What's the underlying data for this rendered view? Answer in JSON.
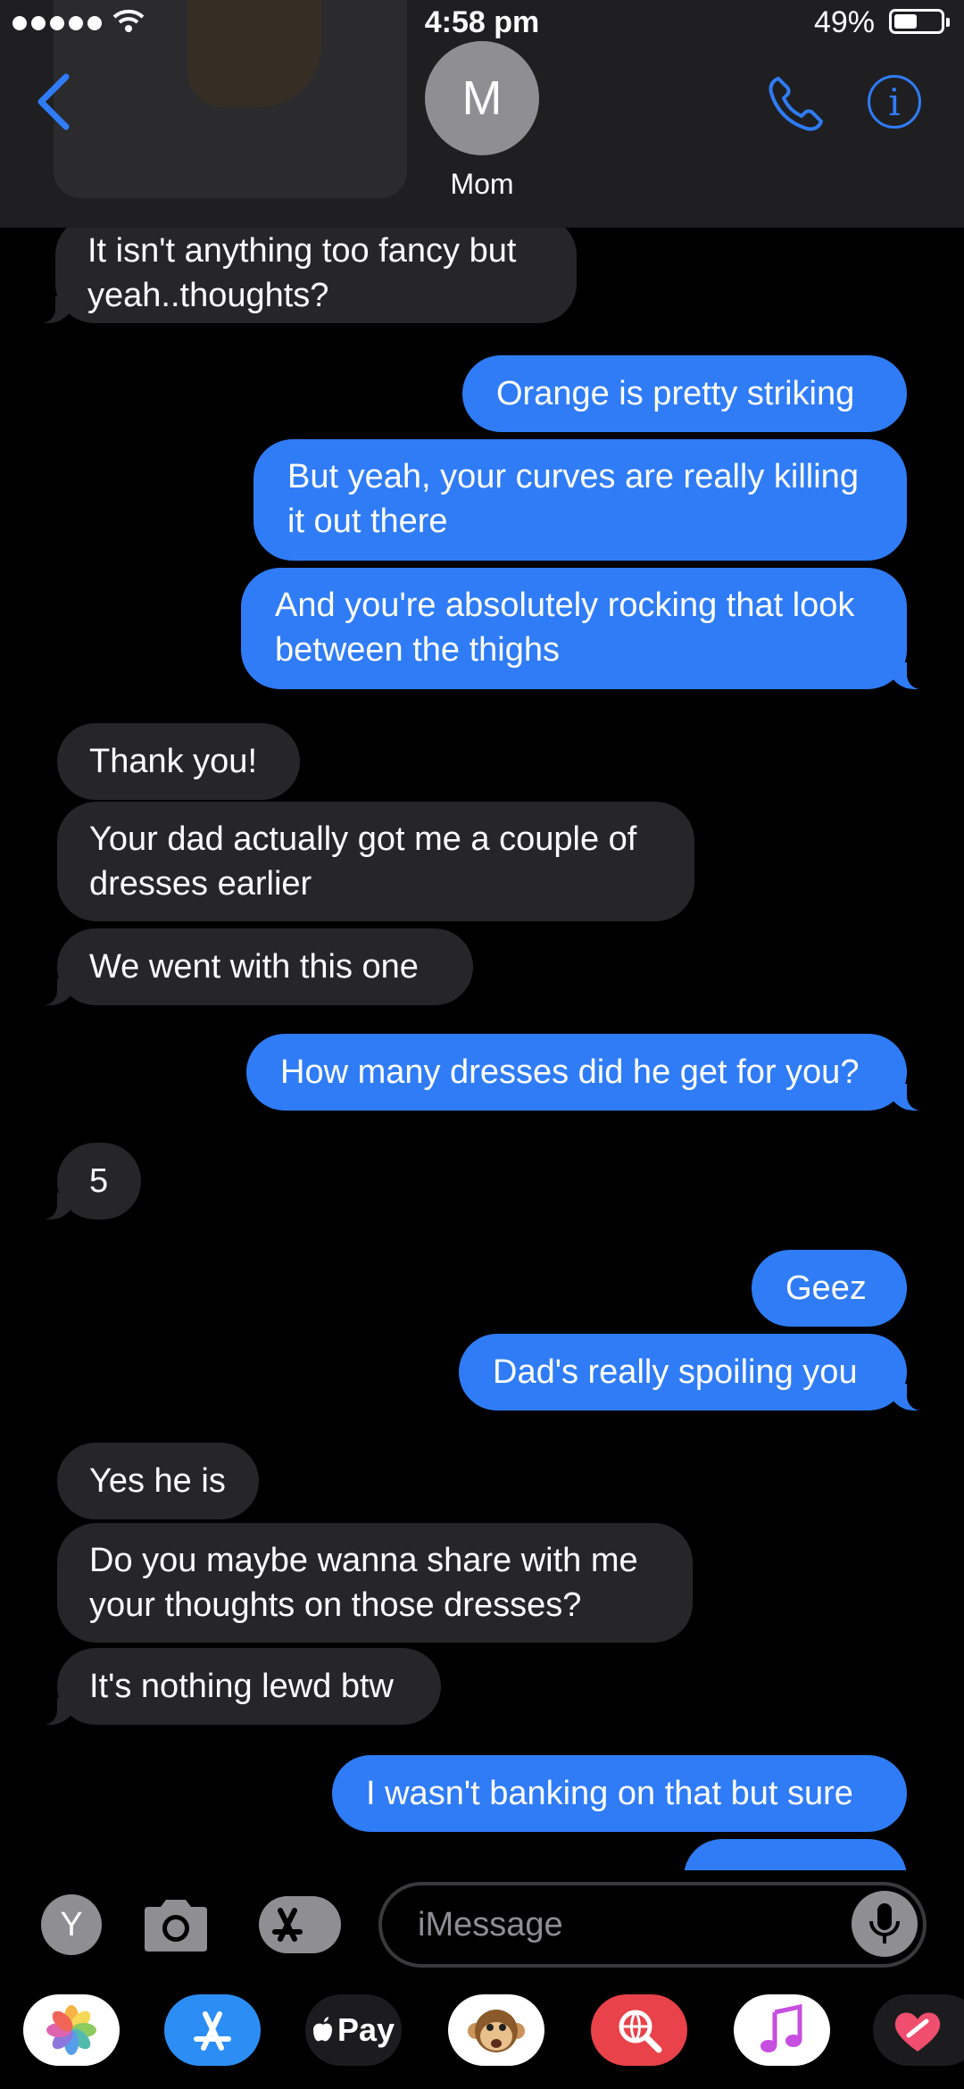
{
  "status_bar": {
    "time": "4:58 pm",
    "battery": "49%",
    "battery_level": 0.49
  },
  "header": {
    "avatar_initial": "M",
    "contact_name": "Mom"
  },
  "messages": [
    {
      "from": "contact",
      "text_lines": [
        "It isn't anything too fancy but",
        "yeah..thoughts?"
      ]
    },
    {
      "from": "me",
      "text": "Orange is pretty striking"
    },
    {
      "from": "me",
      "text_lines": [
        "But yeah, your curves are really killing",
        "it out there"
      ]
    },
    {
      "from": "me",
      "text_lines": [
        "And you're absolutely rocking that look",
        "between the thighs"
      ]
    },
    {
      "from": "contact",
      "text": "Thank you!"
    },
    {
      "from": "contact",
      "text_lines": [
        "Your dad actually got me a couple of",
        "dresses earlier"
      ]
    },
    {
      "from": "contact",
      "text": "We went with this one"
    },
    {
      "from": "me",
      "text": "How many dresses did he get for you?"
    },
    {
      "from": "contact",
      "text": "5"
    },
    {
      "from": "me",
      "text": "Geez"
    },
    {
      "from": "me",
      "text": "Dad's really spoiling you"
    },
    {
      "from": "contact",
      "text": "Yes he is"
    },
    {
      "from": "contact",
      "text_lines": [
        "Do you maybe wanna share with me",
        "your thoughts on those dresses?"
      ]
    },
    {
      "from": "contact",
      "text": "It's nothing lewd btw"
    },
    {
      "from": "me",
      "text": "I wasn't banking on that but sure"
    }
  ],
  "compose": {
    "app_button_letter": "Y",
    "placeholder": "iMessage"
  },
  "app_drawer": {
    "apps": [
      "photos-icon",
      "app-store-icon",
      "apple-pay-icon",
      "animoji-icon",
      "web-search-icon",
      "music-icon",
      "digital-touch-icon"
    ],
    "pay_label": "Pay"
  },
  "colors": {
    "outgoing": "#2f7cf6",
    "incoming": "#262628",
    "header": "#1f1f21",
    "accent": "#2f7cf6"
  }
}
